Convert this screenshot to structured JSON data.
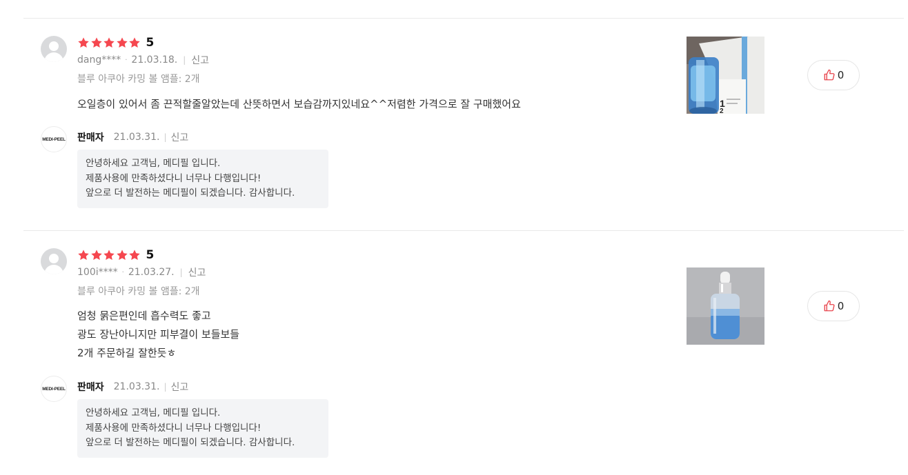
{
  "reviews": [
    {
      "rating_value": 5,
      "score": "5",
      "user": "dang****",
      "date": "21.03.18.",
      "report_label": "신고",
      "option": "블루 아쿠아 카밍 볼 앰플: 2개",
      "content_lines": [
        "오일층이 있어서 좀 끈적할줄알았는데 산뜻하면서 보습감까지있네요^^저렴한 가격으로 잘 구매했어요"
      ],
      "likes": "0",
      "seller": {
        "logo_text": "MEDI-PEEL",
        "name": "판매자",
        "date": "21.03.31.",
        "report_label": "신고",
        "reply_lines": [
          "안녕하세요 고객님, 메디필 입니다.",
          "제품사용에 만족하셨다니 너무나 다행입니다!",
          "앞으로 더 발전하는 메디필이 되겠습니다. 감사합니다."
        ]
      }
    },
    {
      "rating_value": 5,
      "score": "5",
      "user": "100i****",
      "date": "21.03.27.",
      "report_label": "신고",
      "option": "블루 아쿠아 카밍 볼 앰플: 2개",
      "content_lines": [
        "엄청 묽은편인데 흡수력도 좋고",
        "광도 장난아니지만 피부결이 보들보들",
        "2개 주문하길 잘한듯ㅎ"
      ],
      "likes": "0",
      "seller": {
        "logo_text": "MEDI-PEEL",
        "name": "판매자",
        "date": "21.03.31.",
        "report_label": "신고",
        "reply_lines": [
          "안녕하세요 고객님, 메디필 입니다.",
          "제품사용에 만족하셨다니 너무나 다행입니다!",
          "앞으로 더 발전하는 메디필이 되겠습니다. 감사합니다."
        ]
      }
    }
  ],
  "colors": {
    "star": "#f5474f",
    "like_icon": "#e8434b",
    "reply_bg": "#f3f4f6"
  }
}
